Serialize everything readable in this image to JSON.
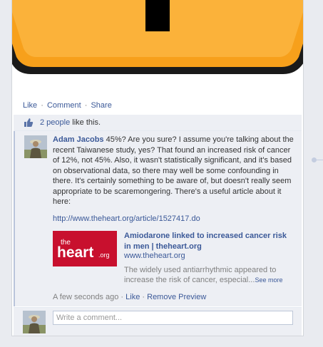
{
  "post": {
    "actions": {
      "like": "Like",
      "comment": "Comment",
      "share": "Share",
      "separator": "·"
    },
    "likes": {
      "count_link": "2 people",
      "suffix": " like this."
    }
  },
  "comment": {
    "author": "Adam Jacobs",
    "body": " 45%? Are you sure? I assume you're talking about the recent Taiwanese study, yes? That found an increased risk of cancer of 12%, not 45%. Also, it wasn't statistically significant, and it's based on observational data, so there may well be some confounding in there. It's certainly something to be aware of, but doesn't really seem appropriate to be scaremongering. There's a useful article about it here:",
    "link": "http://www.theheart.org/article/1527417.do",
    "preview": {
      "logo_text_1": "the",
      "logo_text_2": "heart",
      "logo_text_3": ".org",
      "title": "Amiodarone linked to increased cancer risk in men | theheart.org",
      "domain": "www.theheart.org",
      "description": "The widely used antiarrhythmic appeared to increase the risk of cancer, especial...",
      "see_more": "See more"
    },
    "meta": {
      "time": "A few seconds ago",
      "like": "Like",
      "remove_preview": "Remove Preview",
      "separator": "·"
    }
  },
  "composer": {
    "placeholder": "Write a comment..."
  },
  "colors": {
    "link": "#3b5998",
    "warning_orange": "#f7a01b",
    "panel": "#edeff4"
  },
  "icons": {
    "like": "thumbs-up-icon",
    "warning": "warning-triangle-icon"
  }
}
